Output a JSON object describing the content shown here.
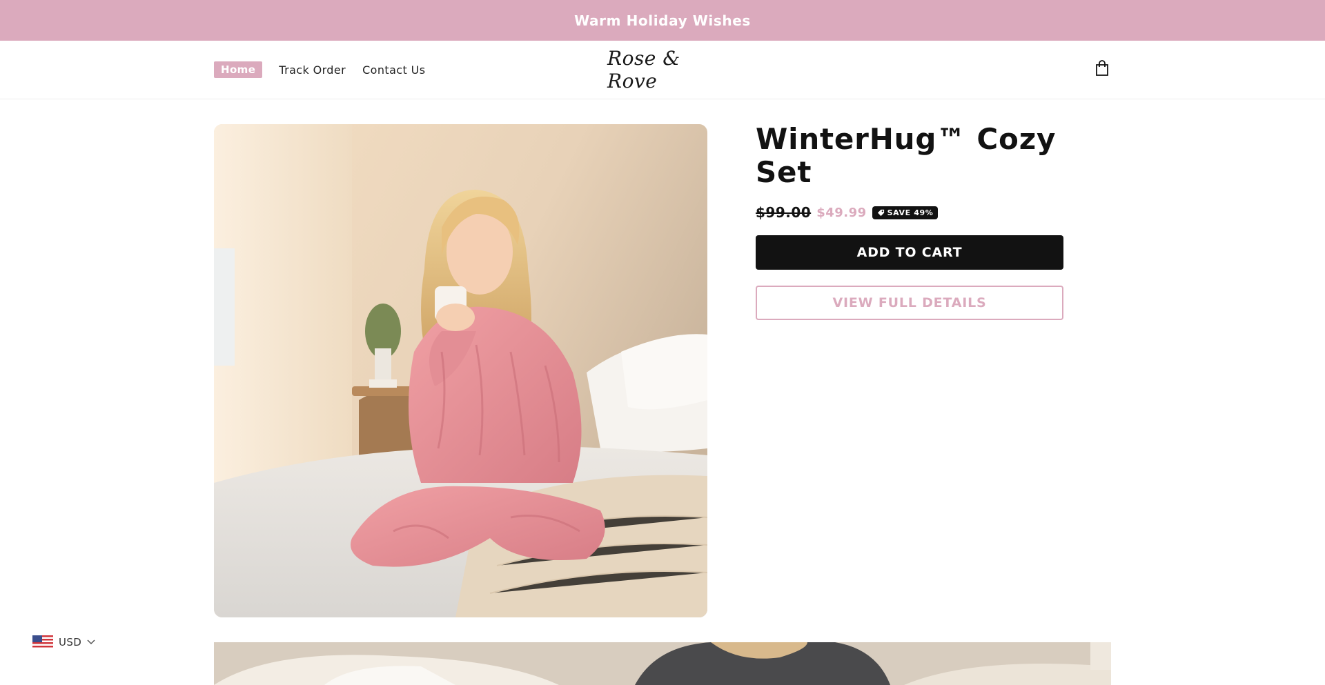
{
  "announcement": {
    "text": "Warm Holiday Wishes"
  },
  "header": {
    "nav": [
      {
        "label": "Home",
        "active": true
      },
      {
        "label": "Track Order",
        "active": false
      },
      {
        "label": "Contact Us",
        "active": false
      }
    ],
    "logo_text": "Rose & Rove",
    "cart_icon": "shopping-bag-icon"
  },
  "product": {
    "title": "WinterHug™ Cozy Set",
    "compare_price": "$99.00",
    "sale_price": "$49.99",
    "badge": "SAVE 49%",
    "badge_icon": "tag-icon",
    "add_to_cart_label": "ADD TO CART",
    "view_details_label": "VIEW FULL DETAILS"
  },
  "currency": {
    "code": "USD",
    "flag_icon": "us-flag-icon"
  },
  "colors": {
    "accent": "#dbaabd",
    "dark": "#121212",
    "white": "#ffffff"
  }
}
